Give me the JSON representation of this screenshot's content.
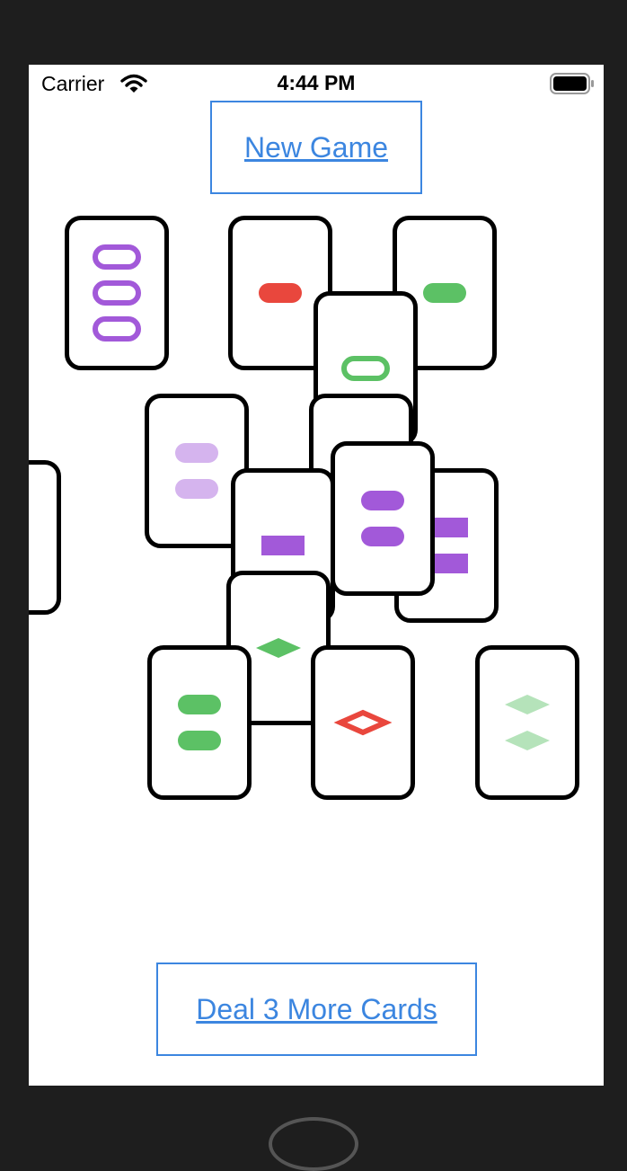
{
  "status_bar": {
    "carrier": "Carrier",
    "time": "4:44 PM"
  },
  "buttons": {
    "new_game": "New Game",
    "deal_more": "Deal 3 More Cards"
  },
  "colors": {
    "accent": "#3c86e0",
    "purple": "#a259d9",
    "red": "#e9473d",
    "green": "#5cc165"
  },
  "cards": [
    {
      "id": "c1",
      "count": 3,
      "shape": "oval",
      "shading": "open",
      "color": "purple"
    },
    {
      "id": "c2",
      "count": 1,
      "shape": "oval",
      "shading": "solid",
      "color": "red"
    },
    {
      "id": "c3",
      "count": 1,
      "shape": "oval",
      "shading": "solid",
      "color": "green"
    },
    {
      "id": "c4",
      "count": 1,
      "shape": "oval",
      "shading": "open",
      "color": "green"
    },
    {
      "id": "c5",
      "count": 2,
      "shape": "oval",
      "shading": "striped",
      "color": "purple"
    },
    {
      "id": "c6",
      "count": 1,
      "shape": "rectangle",
      "shading": "solid",
      "color": "purple"
    },
    {
      "id": "c7",
      "count": null,
      "shape": null,
      "shading": null,
      "color": null
    },
    {
      "id": "c8",
      "count": 2,
      "shape": "rectangle",
      "shading": "solid",
      "color": "purple"
    },
    {
      "id": "c9",
      "count": 1,
      "shape": "rectangle",
      "shading": "solid",
      "color": "purple"
    },
    {
      "id": "c10",
      "count": 2,
      "shape": "oval",
      "shading": "solid",
      "color": "purple"
    },
    {
      "id": "c11",
      "count": 1,
      "shape": "diamond",
      "shading": "solid",
      "color": "green"
    },
    {
      "id": "c12",
      "count": 2,
      "shape": "oval",
      "shading": "solid",
      "color": "green"
    },
    {
      "id": "c13",
      "count": 1,
      "shape": "diamond",
      "shading": "open",
      "color": "red"
    },
    {
      "id": "c14",
      "count": 2,
      "shape": "diamond",
      "shading": "striped",
      "color": "green"
    }
  ]
}
